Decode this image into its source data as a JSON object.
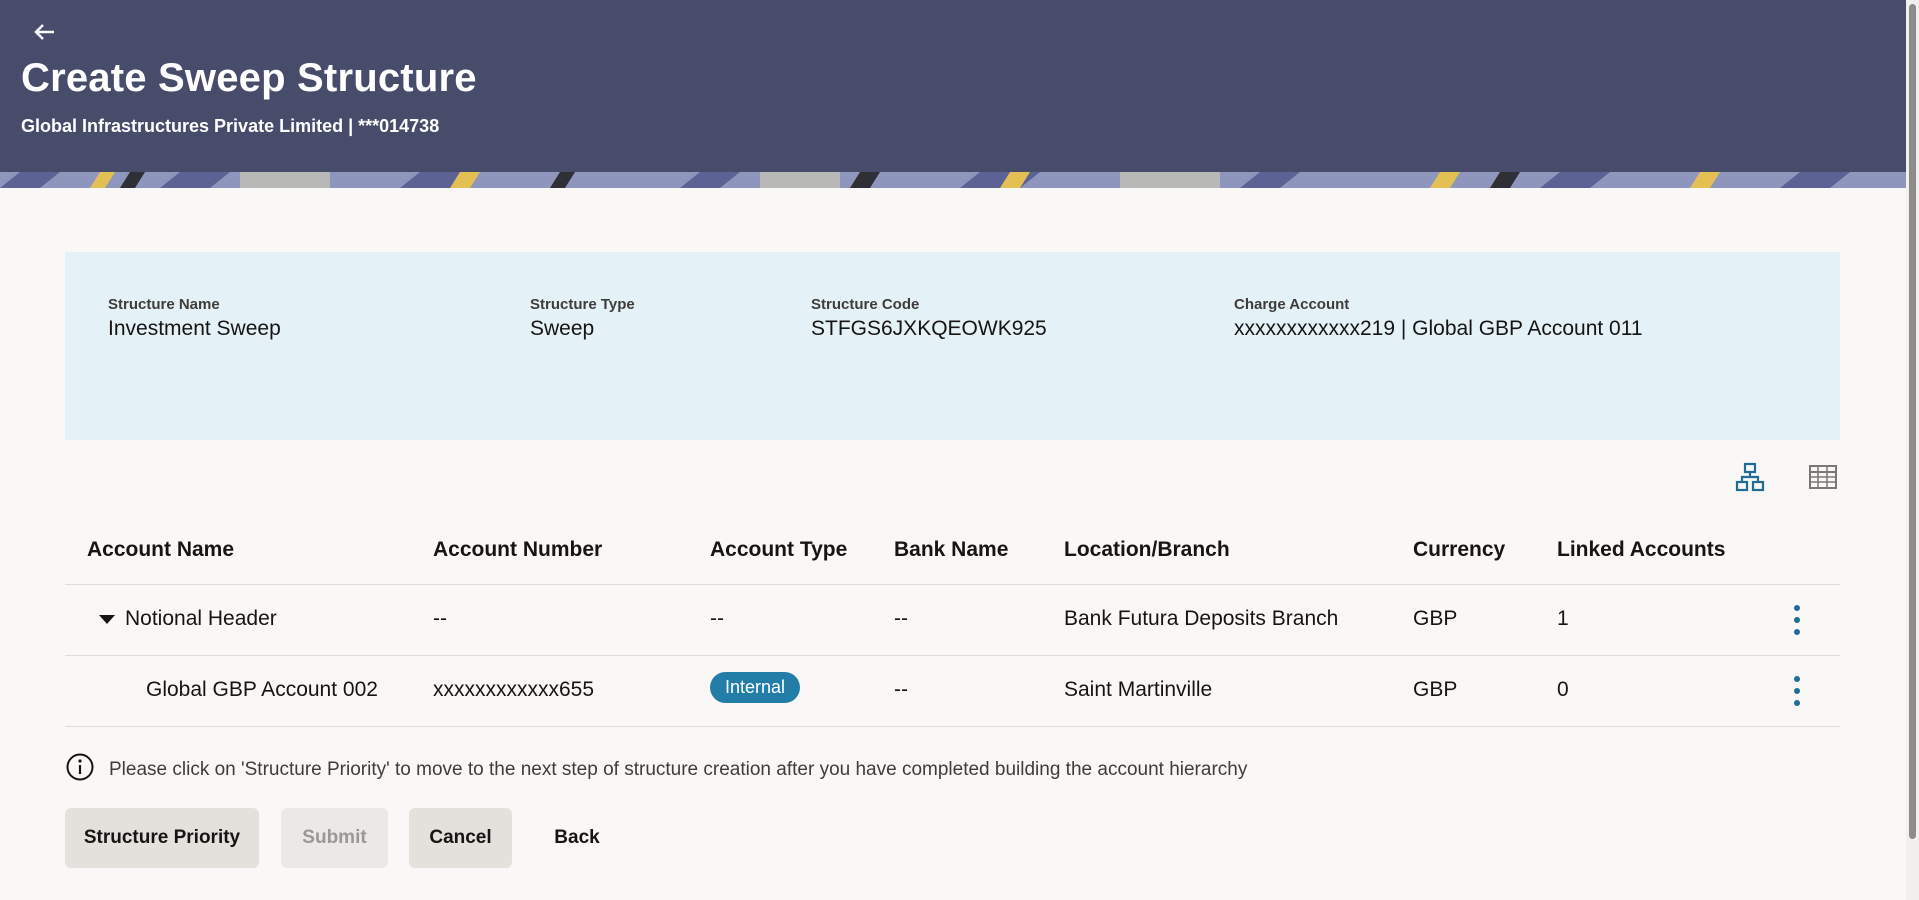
{
  "header": {
    "title": "Create Sweep Structure",
    "subtitle": "Global Infrastructures Private Limited | ***014738",
    "back_icon": "back-arrow-icon",
    "background_color": "#474c6b"
  },
  "summary": {
    "fields": [
      {
        "label": "Structure Name",
        "value": "Investment Sweep"
      },
      {
        "label": "Structure Type",
        "value": "Sweep"
      },
      {
        "label": "Structure Code",
        "value": "STFGS6JXKQEOWK925"
      },
      {
        "label": "Charge Account",
        "value": "xxxxxxxxxxxx219 | Global GBP Account 011"
      }
    ],
    "background_color": "#e4f1f7"
  },
  "view_toggle": {
    "icons": [
      "hierarchy-icon",
      "table-view-icon"
    ]
  },
  "table": {
    "columns": [
      "Account Name",
      "Account Number",
      "Account Type",
      "Bank Name",
      "Location/Branch",
      "Currency",
      "Linked Accounts"
    ],
    "rows": [
      {
        "account_name": "Notional Header",
        "account_number": "--",
        "account_type": "--",
        "bank_name": "--",
        "location": "Bank Futura Deposits Branch",
        "currency": "GBP",
        "linked_accounts": "1",
        "expanded": true
      },
      {
        "account_name": "Global GBP Account 002",
        "account_number": "xxxxxxxxxxxx655",
        "account_type": "Internal",
        "bank_name": "--",
        "location": "Saint Martinville",
        "currency": "GBP",
        "linked_accounts": "0"
      }
    ]
  },
  "info": {
    "icon": "info-icon",
    "text": "Please click on 'Structure Priority' to move to the next step of structure creation after you have completed building the account hierarchy"
  },
  "actions": {
    "structure_priority": "Structure Priority",
    "submit": "Submit",
    "cancel": "Cancel",
    "back": "Back"
  },
  "colors": {
    "accent": "#227ea6",
    "icon_blue": "#1f6c96"
  }
}
